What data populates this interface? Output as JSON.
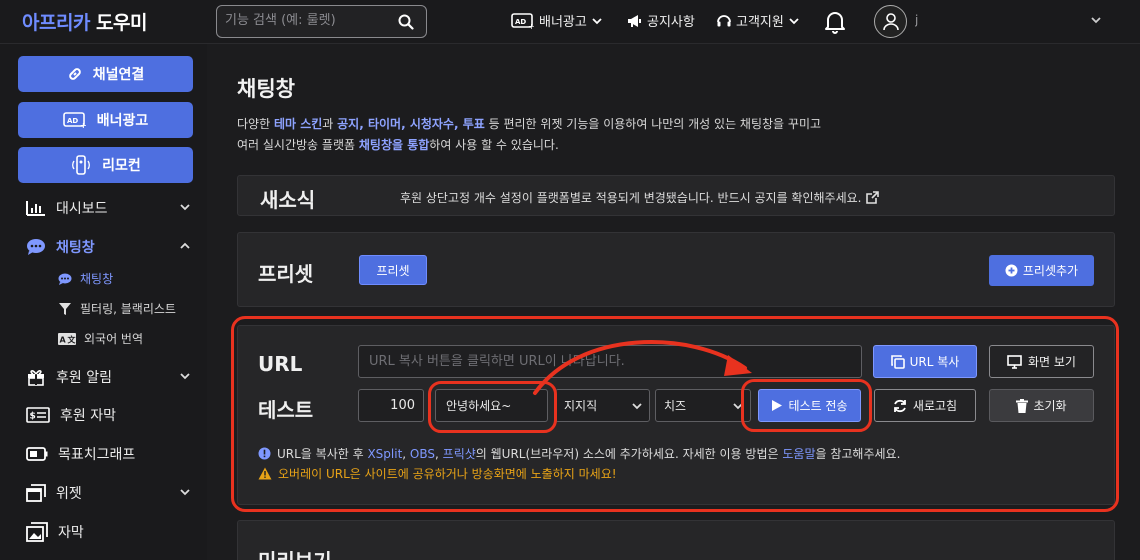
{
  "app": {
    "logo_part1": "아프리카",
    "logo_part2": "도우미"
  },
  "search": {
    "placeholder": "기능 검색 (예: 룰렛)"
  },
  "topnav": {
    "banner_ad": "배너광고",
    "notice": "공지사항",
    "support": "고객지원",
    "username": "j                "
  },
  "sidebar": {
    "buttons": [
      {
        "label": "채널연결",
        "icon": "link-icon"
      },
      {
        "label": "배너광고",
        "icon": "ad-icon"
      },
      {
        "label": "리모컨",
        "icon": "remote-icon"
      }
    ],
    "items": [
      {
        "label": "대시보드",
        "icon": "chart-icon",
        "expanded": false
      },
      {
        "label": "채팅창",
        "icon": "chat-icon",
        "expanded": true,
        "active": true
      },
      {
        "label": "후원 알림",
        "icon": "gift-icon",
        "expanded": false
      },
      {
        "label": "후원 자막",
        "icon": "money-icon"
      },
      {
        "label": "목표치그래프",
        "icon": "battery-icon"
      },
      {
        "label": "위젯",
        "icon": "window-icon",
        "expanded": false
      },
      {
        "label": "자막",
        "icon": "image-icon"
      }
    ],
    "subitems": [
      {
        "label": "채팅창",
        "icon": "chat-icon",
        "active": true
      },
      {
        "label": "필터링, 블랙리스트",
        "icon": "filter-icon"
      },
      {
        "label": "외국어 번역",
        "icon": "translate-icon"
      }
    ]
  },
  "main": {
    "title": "채팅창",
    "desc_line1_pre": "다양한 ",
    "desc_b1": "테마 스킨",
    "desc_mid1": "과 ",
    "desc_b2": "공지, 타이머, 시청자수, 투표",
    "desc_post1": " 등 편리한 위젯 기능을 이용하여 나만의 개성 있는 채팅창을 꾸미고",
    "desc_line2_pre": "여러 실시간방송 플랫폼 ",
    "desc_b3": "채팅창을 통합",
    "desc_post2": "하여 사용 할 수 있습니다."
  },
  "notice_card": {
    "title": "새소식",
    "text": "후원 상단고정 개수 설정이 플랫폼별로 적용되게 변경됐습니다. 반드시 공지를 확인해주세요."
  },
  "preset_card": {
    "title": "프리셋",
    "preset_button": "프리셋",
    "add_button": "프리셋추가"
  },
  "url_card": {
    "url_label": "URL",
    "url_placeholder": "URL 복사 버튼을 클릭하면 URL이 나타납니다.",
    "copy_button": "URL 복사",
    "view_button": "화면 보기",
    "test_label": "테스트",
    "amount": "100",
    "message": "안녕하세요~",
    "select1": "지지직",
    "select2": "치즈",
    "send_button": "테스트 전송",
    "refresh_button": "새로고침",
    "reset_button": "초기화",
    "info_pre": "URL을 복사한 후 ",
    "info_link1": "XSplit",
    "info_sep1": ", ",
    "info_link2": "OBS",
    "info_sep2": ", ",
    "info_link3": "프릭샷",
    "info_mid": "의 웹URL(브라우저) 소스에 추가하세요. 자세한 이용 방법은 ",
    "info_link4": "도움말",
    "info_post": "을 참고해주세요.",
    "warning": "오버레이 URL은 사이트에 공유하거나 방송화면에 노출하지 마세요!"
  },
  "preview_card": {
    "title": "미리보기"
  },
  "colors": {
    "accent": "#4e6fe0",
    "link": "#7f98ff",
    "warning": "#e8a317",
    "annotation": "#e8321f"
  }
}
